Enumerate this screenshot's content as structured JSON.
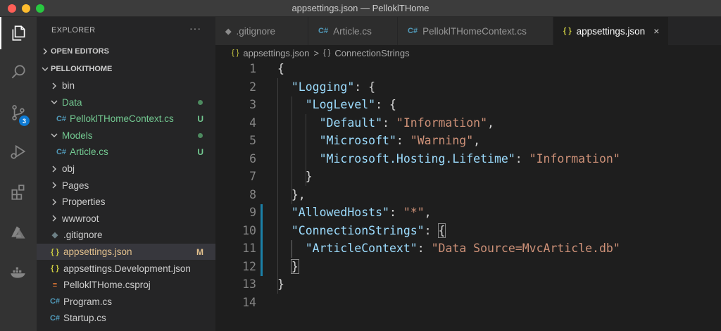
{
  "window": {
    "title": "appsettings.json — PelloklTHome"
  },
  "activity_bar": {
    "items": [
      {
        "name": "explorer-icon",
        "active": true
      },
      {
        "name": "search-icon"
      },
      {
        "name": "source-control-icon",
        "badge": "3"
      },
      {
        "name": "run-debug-icon"
      },
      {
        "name": "extensions-icon"
      },
      {
        "name": "azure-icon"
      },
      {
        "name": "docker-icon"
      }
    ]
  },
  "sidebar": {
    "header": "EXPLORER",
    "more": "···",
    "open_editors": "OPEN EDITORS",
    "project": "PELLOKITHOME",
    "tree": [
      {
        "label": "bin",
        "type": "folder",
        "expanded": false,
        "depth": 1
      },
      {
        "label": "Data",
        "type": "folder",
        "expanded": true,
        "depth": 1,
        "status": "dot"
      },
      {
        "label": "PelloklTHomeContext.cs",
        "type": "cs",
        "depth": 2,
        "status": "U"
      },
      {
        "label": "Models",
        "type": "folder",
        "expanded": true,
        "depth": 1,
        "status": "dot"
      },
      {
        "label": "Article.cs",
        "type": "cs",
        "depth": 2,
        "status": "U"
      },
      {
        "label": "obj",
        "type": "folder",
        "expanded": false,
        "depth": 1
      },
      {
        "label": "Pages",
        "type": "folder",
        "expanded": false,
        "depth": 1
      },
      {
        "label": "Properties",
        "type": "folder",
        "expanded": false,
        "depth": 1
      },
      {
        "label": "wwwroot",
        "type": "folder",
        "expanded": false,
        "depth": 1
      },
      {
        "label": ".gitignore",
        "type": "git",
        "depth": 1
      },
      {
        "label": "appsettings.json",
        "type": "json",
        "depth": 1,
        "status": "M",
        "selected": true
      },
      {
        "label": "appsettings.Development.json",
        "type": "json",
        "depth": 1
      },
      {
        "label": "PelloklTHome.csproj",
        "type": "rss",
        "depth": 1
      },
      {
        "label": "Program.cs",
        "type": "cs",
        "depth": 1
      },
      {
        "label": "Startup.cs",
        "type": "cs",
        "depth": 1
      }
    ]
  },
  "tabs": [
    {
      "label": ".gitignore",
      "icon": "◆"
    },
    {
      "label": "Article.cs",
      "icon": "C#"
    },
    {
      "label": "PelloklTHomeContext.cs",
      "icon": "C#"
    },
    {
      "label": "appsettings.json",
      "icon": "{ }",
      "active": true,
      "close": "×"
    }
  ],
  "breadcrumb": {
    "file": "appsettings.json",
    "symbol": "ConnectionStrings",
    "file_icon": "{ }",
    "symbol_icon": "{ }",
    "separator": ">"
  },
  "editor": {
    "lines": [
      {
        "n": "1",
        "tokens": [
          [
            "punc",
            "{"
          ]
        ]
      },
      {
        "n": "2",
        "tokens": [
          [
            "punc",
            "  "
          ],
          [
            "key",
            "\"Logging\""
          ],
          [
            "punc",
            ": {"
          ]
        ]
      },
      {
        "n": "3",
        "tokens": [
          [
            "punc",
            "    "
          ],
          [
            "key",
            "\"LogLevel\""
          ],
          [
            "punc",
            ": {"
          ]
        ]
      },
      {
        "n": "4",
        "tokens": [
          [
            "punc",
            "      "
          ],
          [
            "key",
            "\"Default\""
          ],
          [
            "punc",
            ": "
          ],
          [
            "str",
            "\"Information\""
          ],
          [
            "punc",
            ","
          ]
        ]
      },
      {
        "n": "5",
        "tokens": [
          [
            "punc",
            "      "
          ],
          [
            "key",
            "\"Microsoft\""
          ],
          [
            "punc",
            ": "
          ],
          [
            "str",
            "\"Warning\""
          ],
          [
            "punc",
            ","
          ]
        ]
      },
      {
        "n": "6",
        "tokens": [
          [
            "punc",
            "      "
          ],
          [
            "key",
            "\"Microsoft.Hosting.Lifetime\""
          ],
          [
            "punc",
            ": "
          ],
          [
            "str",
            "\"Information\""
          ]
        ]
      },
      {
        "n": "7",
        "tokens": [
          [
            "punc",
            "    }"
          ]
        ]
      },
      {
        "n": "8",
        "tokens": [
          [
            "punc",
            "  },"
          ]
        ]
      },
      {
        "n": "9",
        "tokens": [
          [
            "punc",
            "  "
          ],
          [
            "key",
            "\"AllowedHosts\""
          ],
          [
            "punc",
            ": "
          ],
          [
            "str",
            "\"*\""
          ],
          [
            "punc",
            ","
          ]
        ]
      },
      {
        "n": "10",
        "tokens": [
          [
            "punc",
            "  "
          ],
          [
            "key",
            "\"ConnectionStrings\""
          ],
          [
            "punc",
            ": "
          ],
          [
            "hl",
            "{"
          ]
        ]
      },
      {
        "n": "11",
        "tokens": [
          [
            "punc",
            "    "
          ],
          [
            "key",
            "\"ArticleContext\""
          ],
          [
            "punc",
            ": "
          ],
          [
            "str",
            "\"Data Source=MvcArticle.db\""
          ]
        ]
      },
      {
        "n": "12",
        "tokens": [
          [
            "punc",
            "  "
          ],
          [
            "hl",
            "}"
          ]
        ]
      },
      {
        "n": "13",
        "tokens": [
          [
            "punc",
            "}"
          ]
        ]
      },
      {
        "n": "14",
        "tokens": []
      }
    ],
    "modified_lines": [
      "9",
      "10",
      "11",
      "12"
    ]
  }
}
